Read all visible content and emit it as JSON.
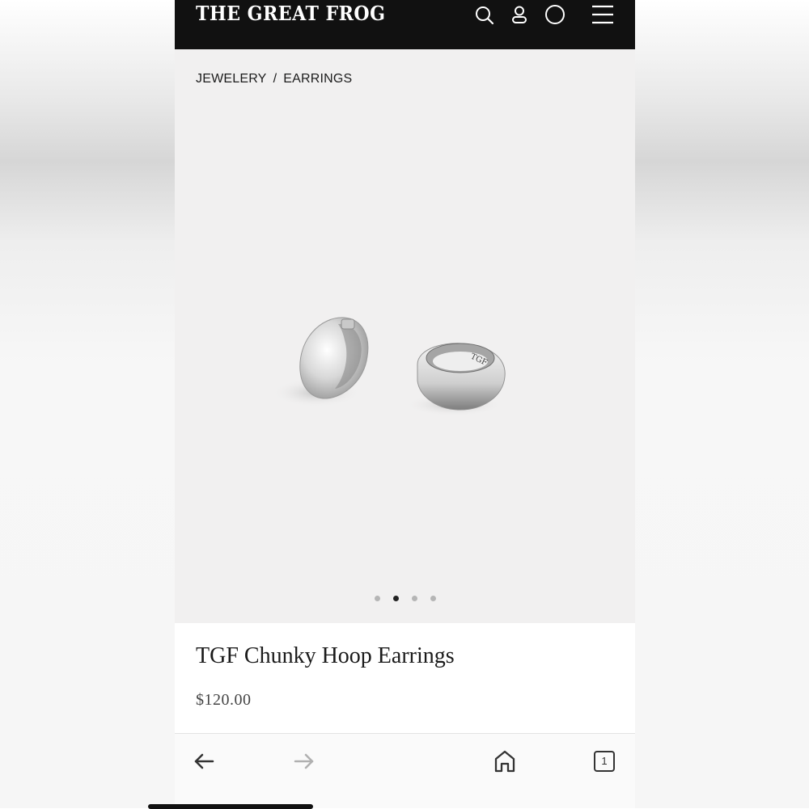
{
  "header": {
    "logo_text": "THE GREAT FROG",
    "icons": [
      "search-icon",
      "account-icon",
      "cart-icon",
      "menu-icon"
    ]
  },
  "breadcrumb": {
    "items": [
      "JEWELERY",
      "EARRINGS"
    ],
    "separator": "/"
  },
  "gallery": {
    "image": "silver chunky hoop earrings",
    "slide_count": 4,
    "active_slide": 2
  },
  "product": {
    "title": "TGF Chunky Hoop Earrings",
    "price": "$120.00"
  },
  "browser": {
    "tab_count": "1",
    "icons": [
      "back-arrow-icon",
      "forward-arrow-icon",
      "home-icon",
      "tabs-icon"
    ]
  },
  "colors": {
    "header_bg": "#111111",
    "media_bg": "#f1f0f0",
    "active_dot": "#222222",
    "inactive_dot": "#b5b5b5"
  }
}
